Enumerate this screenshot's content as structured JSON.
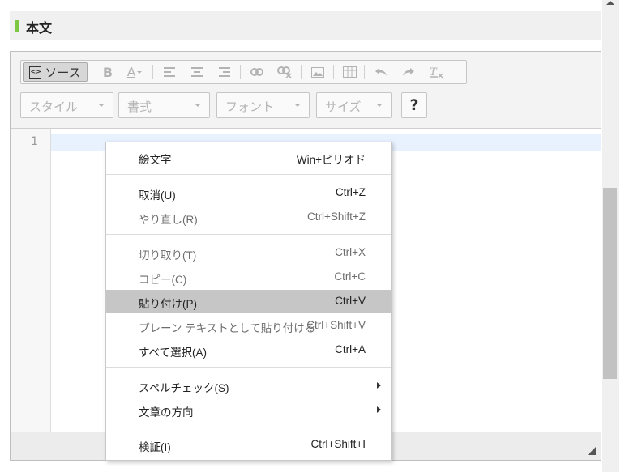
{
  "section": {
    "title": "本文"
  },
  "toolbar": {
    "source_label": "ソース",
    "buttons": [
      "bold",
      "text-color",
      "align-left",
      "align-center",
      "align-right",
      "link",
      "unlink",
      "image",
      "table",
      "undo",
      "redo",
      "remove-format"
    ],
    "bold_glyph": "B",
    "color_glyph": "A",
    "combos": {
      "style": "スタイル",
      "format": "書式",
      "font": "フォント",
      "size": "サイズ"
    },
    "help_label": "?"
  },
  "editor": {
    "line_number": "1"
  },
  "context_menu": {
    "items": [
      {
        "label": "絵文字",
        "shortcut": "Win+ピリオド",
        "enabled": true
      },
      {
        "label": "取消(U)",
        "shortcut": "Ctrl+Z",
        "enabled": true
      },
      {
        "label": "やり直し(R)",
        "shortcut": "Ctrl+Shift+Z",
        "enabled": false
      },
      {
        "label": "切り取り(T)",
        "shortcut": "Ctrl+X",
        "enabled": false
      },
      {
        "label": "コピー(C)",
        "shortcut": "Ctrl+C",
        "enabled": false
      },
      {
        "label": "貼り付け(P)",
        "shortcut": "Ctrl+V",
        "enabled": true,
        "highlighted": true
      },
      {
        "label": "プレーン テキストとして貼り付ける",
        "shortcut": "Ctrl+Shift+V",
        "enabled": false
      },
      {
        "label": "すべて選択(A)",
        "shortcut": "Ctrl+A",
        "enabled": true
      },
      {
        "label": "スペルチェック(S)",
        "shortcut": "",
        "enabled": true,
        "submenu": true
      },
      {
        "label": "文章の方向",
        "shortcut": "",
        "enabled": true,
        "submenu": true
      },
      {
        "label": "検証(I)",
        "shortcut": "Ctrl+Shift+I",
        "enabled": true
      }
    ]
  },
  "colors": {
    "accent_bar": "#7dc742",
    "highlight": "#c6c6c6",
    "active_line": "#e8f2ff"
  }
}
